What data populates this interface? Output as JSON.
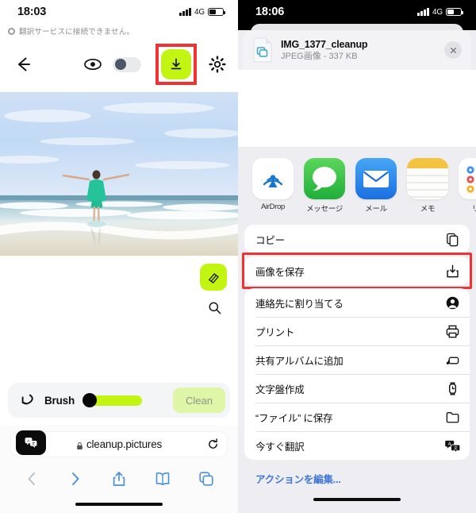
{
  "left_phone": {
    "status_bar": {
      "time": "18:03",
      "network": "4G",
      "battery_level": 48
    },
    "notice": {
      "text": "翻訳サービスに接続できません。",
      "icon": "info-circle-icon"
    },
    "toolbar": {
      "back_icon": "arrow-left-icon",
      "preview_icon": "eye-icon",
      "toggle_state": "off",
      "download_icon": "download-icon",
      "download_highlight_color": "#ef3232",
      "accent_color": "#c2f511",
      "settings_icon": "gear-icon"
    },
    "canvas": {
      "photo_alt": "beach-photo-woman-arms-raised",
      "eraser_icon": "eraser-icon",
      "zoom_icon": "magnifier-icon"
    },
    "brush_bar": {
      "undo_icon": "undo-arrow-icon",
      "label": "Brush",
      "slider_value": 8,
      "clean_label": "Clean"
    },
    "safari": {
      "translate_icon": "translate-icon",
      "lock_icon": "lock-icon",
      "url": "cleanup.pictures",
      "reload_icon": "reload-icon",
      "nav": [
        {
          "name": "back",
          "icon": "chevron-left-icon",
          "enabled": false
        },
        {
          "name": "forward",
          "icon": "chevron-right-icon",
          "enabled": true
        },
        {
          "name": "share",
          "icon": "share-icon",
          "enabled": true
        },
        {
          "name": "bookmarks",
          "icon": "book-icon",
          "enabled": true
        },
        {
          "name": "tabs",
          "icon": "tabs-icon",
          "enabled": true
        }
      ]
    }
  },
  "right_phone": {
    "status_bar": {
      "time": "18:06",
      "network": "4G",
      "battery_level": 48
    },
    "file": {
      "name": "IMG_1377_cleanup",
      "subtitle": "JPEG画像 - 337 KB",
      "icon": "jpeg-file-icon",
      "close_icon": "close-icon"
    },
    "apps": [
      {
        "label": "AirDrop",
        "icon": "airdrop-icon"
      },
      {
        "label": "メッセージ",
        "icon": "messages-icon"
      },
      {
        "label": "メール",
        "icon": "mail-icon"
      },
      {
        "label": "メモ",
        "icon": "notes-icon"
      },
      {
        "label": "リマ",
        "icon": "reminders-icon"
      }
    ],
    "menu_group_1": [
      {
        "label": "コピー",
        "icon": "copy-icon"
      }
    ],
    "menu_highlighted": [
      {
        "label": "画像を保存",
        "icon": "save-image-icon"
      }
    ],
    "menu_group_2": [
      {
        "label": "連絡先に割り当てる",
        "icon": "contact-icon"
      },
      {
        "label": "プリント",
        "icon": "printer-icon"
      },
      {
        "label": "共有アルバムに追加",
        "icon": "shared-album-icon"
      },
      {
        "label": "文字盤作成",
        "icon": "watch-face-icon"
      },
      {
        "label": "“ファイル” に保存",
        "icon": "folder-icon"
      },
      {
        "label": "今すぐ翻訳",
        "icon": "translate-icon"
      }
    ],
    "edit_actions_label": "アクションを編集...",
    "highlight_color": "#ef3232",
    "link_color": "#3f76d6"
  }
}
